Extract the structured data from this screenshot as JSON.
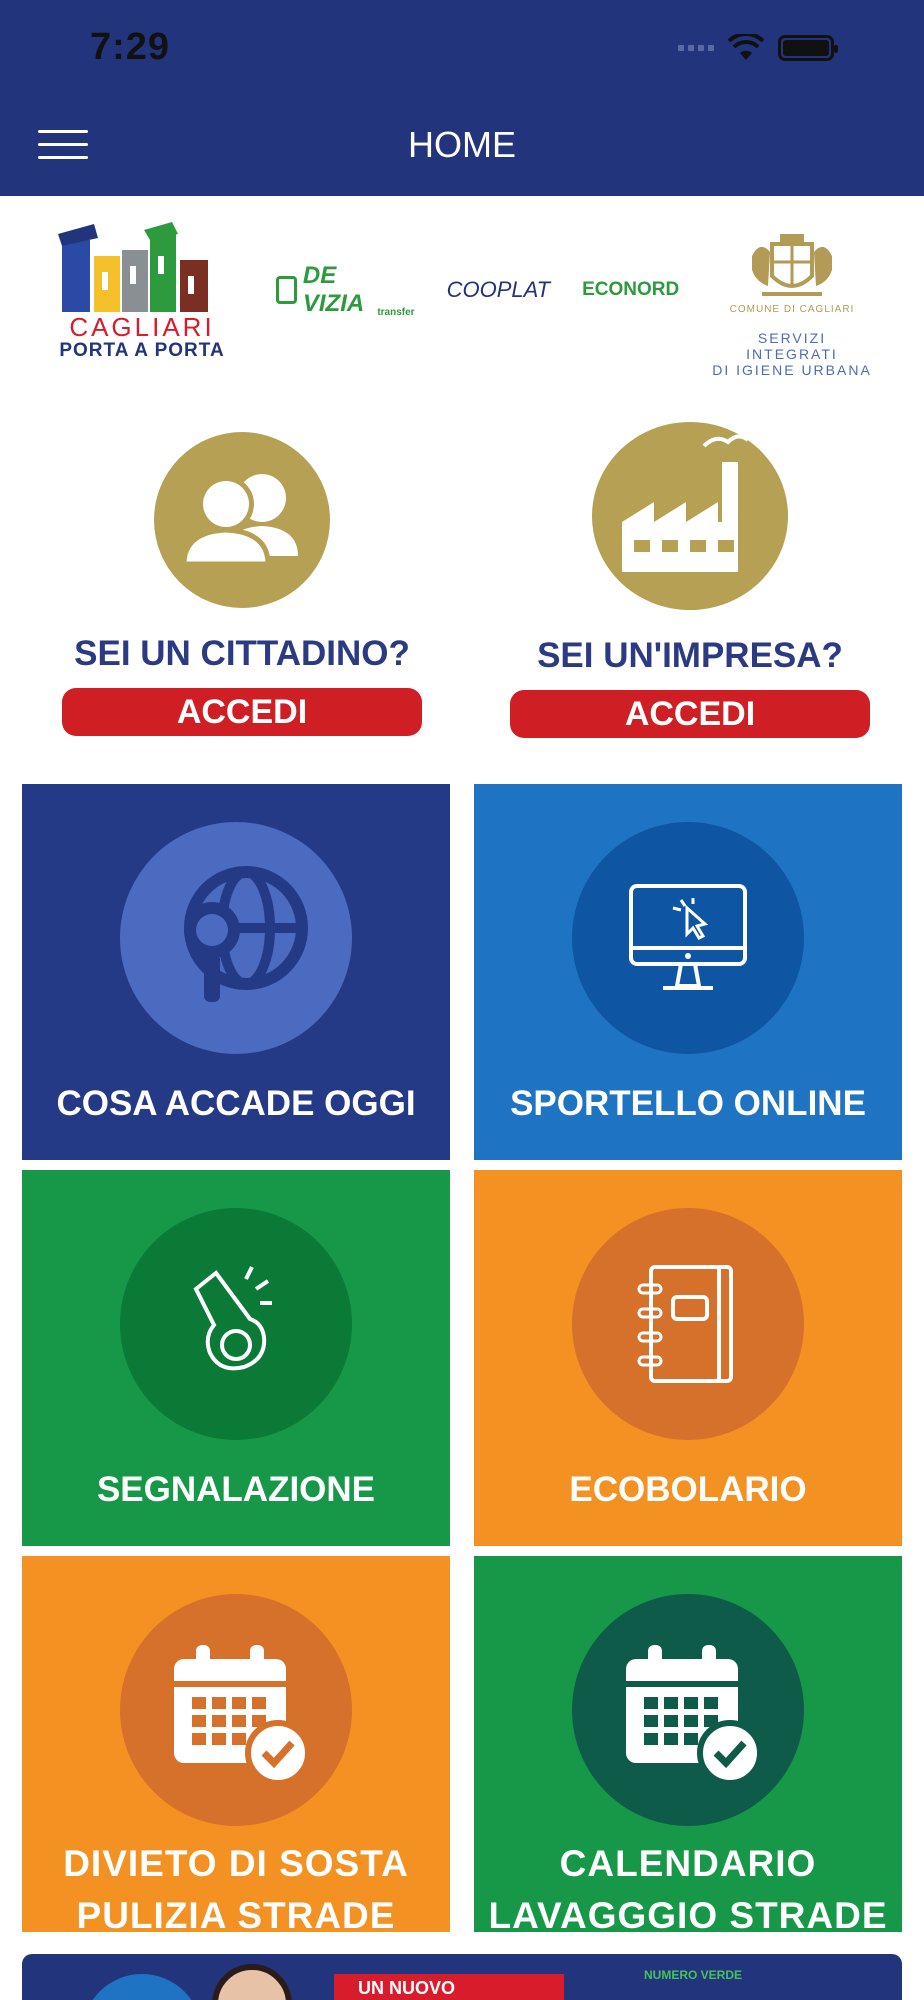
{
  "status_bar": {
    "time": "7:29"
  },
  "header": {
    "title": "HOME"
  },
  "logos": {
    "cagliari_line1": "CAGLIARI",
    "cagliari_line2": "PORTA A PORTA",
    "partner_1": "DE VIZIA",
    "partner_1_sub": "transfer",
    "partner_2": "COOPLAT",
    "partner_3": "ECONORD",
    "comune_small": "COMUNE DI CAGLIARI",
    "comune_services_1": "SERVIZI INTEGRATI",
    "comune_services_2": "DI IGIENE URBANA"
  },
  "accounts": [
    {
      "question": "SEI UN CITTADINO?",
      "button": "ACCEDI"
    },
    {
      "question": "SEI UN'IMPRESA?",
      "button": "ACCEDI"
    }
  ],
  "tiles": [
    {
      "label": "COSA ACCADE OGGI",
      "icon": "globe-search-icon"
    },
    {
      "label": "SPORTELLO ONLINE",
      "icon": "computer-cursor-icon"
    },
    {
      "label": "SEGNALAZIONE",
      "icon": "whistle-icon"
    },
    {
      "label": "ECOBOLARIO",
      "icon": "notebook-icon"
    },
    {
      "label_line1": "DIVIETO DI SOSTA",
      "label_line2": "PULIZIA STRADE",
      "icon": "calendar-check-icon"
    },
    {
      "label_line1": "CALENDARIO",
      "label_line2": "LAVAGGGIO STRADE",
      "icon": "calendar-check-icon"
    }
  ],
  "banner": {
    "red_text": "UN NUOVO",
    "green_text": "NUMERO VERDE"
  },
  "colors": {
    "header": "#22357c",
    "gold": "#b5a054",
    "red_button": "#cf1f25",
    "tile_blue": "#253a86",
    "tile_lightblue": "#1e74c2",
    "tile_green": "#169848",
    "tile_orange": "#f39223"
  }
}
